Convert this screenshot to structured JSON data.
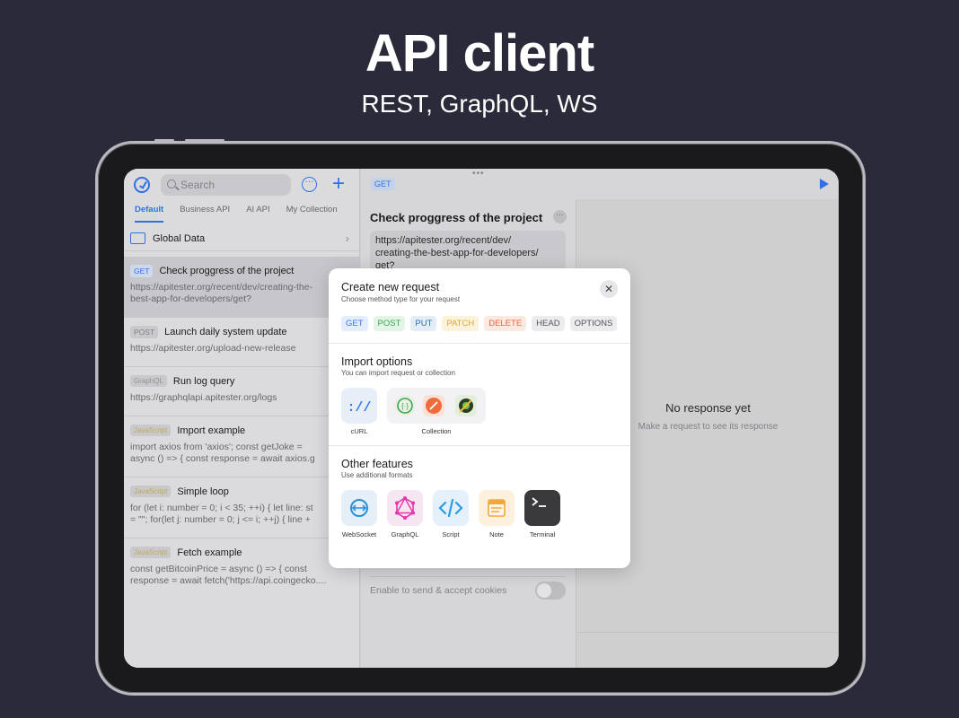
{
  "hero": {
    "title": "API client",
    "subtitle": "REST, GraphQL, WS"
  },
  "sidebar": {
    "search_placeholder": "Search",
    "tabs": [
      "Default",
      "Business API",
      "AI API",
      "My Collection"
    ],
    "global_data": "Global Data",
    "requests": [
      {
        "method": "GET",
        "title": "Check proggress of the project",
        "sub": "https://apitester.org/recent/dev/creating-the-\nbest-app-for-developers/get?"
      },
      {
        "method": "POST",
        "title": "Launch daily system update",
        "sub": "https://apitester.org/upload-new-release"
      },
      {
        "method": "GraphQL",
        "title": "Run log query",
        "sub": "https://graphqlapi.apitester.org/logs"
      },
      {
        "method": "JavaScript",
        "title": "Import example",
        "sub": "import axios from 'axios'; const getJoke =\nasync () => { const response = await axios.g"
      },
      {
        "method": "JavaScript",
        "title": "Simple loop",
        "sub": "for (let i: number = 0; i < 35; ++i) { let line: st\n= \"\"; for(let j: number = 0; j <= i; ++j) { line +"
      },
      {
        "method": "JavaScript",
        "title": "Fetch example",
        "sub": "const getBitcoinPrice = async () => { const\nresponse = await fetch('https://api.coingecko...."
      }
    ]
  },
  "editor": {
    "method": "GET",
    "title": "Check proggress of the project",
    "url": "https://apitester.org/recent/dev/\ncreating-the-best-app-for-developers/\nget?",
    "cookies_label": "Enable to send & accept cookies"
  },
  "response": {
    "empty_title": "No response yet",
    "empty_sub": "Make a request to see its response"
  },
  "modal": {
    "title": "Create new request",
    "subtitle": "Choose method type for your request",
    "methods": [
      {
        "label": "GET",
        "color": "#3478f6",
        "bg": "#e3edfd"
      },
      {
        "label": "POST",
        "color": "#34a853",
        "bg": "#e4f4e6"
      },
      {
        "label": "PUT",
        "color": "#2c6fb8",
        "bg": "#e4ecf6"
      },
      {
        "label": "PATCH",
        "color": "#e0a82e",
        "bg": "#fdf2dc"
      },
      {
        "label": "DELETE",
        "color": "#e8663d",
        "bg": "#fde9e2"
      },
      {
        "label": "HEAD",
        "color": "#555559",
        "bg": "#ececef"
      },
      {
        "label": "OPTIONS",
        "color": "#555559",
        "bg": "#ececef"
      }
    ],
    "import_title": "Import options",
    "import_subtitle": "You can import request or collection",
    "curl_label": "cURL",
    "collection_label": "Collection",
    "other_title": "Other features",
    "other_subtitle": "Use additional formats",
    "features": [
      "WebSocket",
      "GraphQL",
      "Script",
      "Note",
      "Terminal"
    ]
  }
}
